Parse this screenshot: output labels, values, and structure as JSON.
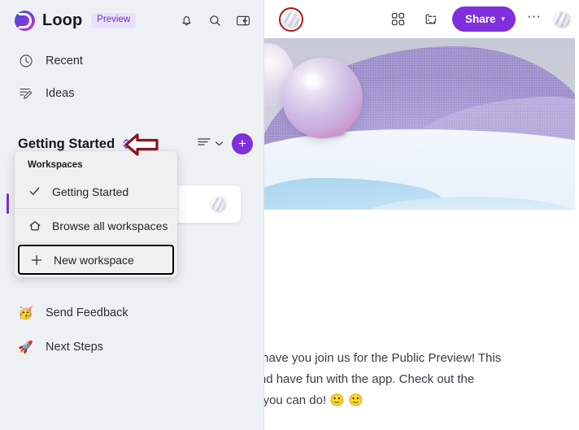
{
  "app": {
    "name": "Loop",
    "badge": "Preview"
  },
  "sidebar": {
    "header_icons": [
      {
        "name": "notifications-icon",
        "label": "Notifications"
      },
      {
        "name": "search-icon",
        "label": "Search"
      },
      {
        "name": "collapse-panel-icon",
        "label": "Collapse navigation"
      }
    ],
    "nav": [
      {
        "label": "Recent",
        "icon": "clock-icon"
      },
      {
        "label": "Ideas",
        "icon": "pencil-board-icon"
      }
    ],
    "workspace": {
      "title": "Getting Started",
      "chevron_icon": "chevron-up-down-icon",
      "sort_icon": "sort-lines-icon",
      "sort_chevron_icon": "chevron-down-icon",
      "add_label": "+"
    },
    "bottom_nav": [
      {
        "label": "Send Feedback",
        "emoji": "🥳"
      },
      {
        "label": "Next Steps",
        "emoji": "🚀"
      }
    ]
  },
  "menu": {
    "section_label": "Workspaces",
    "items": [
      {
        "label": "Getting Started",
        "icon": "check-icon",
        "checked": true
      },
      {
        "label": "Browse all workspaces",
        "icon": "home-icon",
        "checked": false
      },
      {
        "label": "New workspace",
        "icon": "plus-icon",
        "checked": false,
        "highlighted": true
      }
    ]
  },
  "main": {
    "topbar": {
      "doc_icon": "document-thumbnail-icon",
      "grid_icon": "apps-grid-icon",
      "components_icon": "components-icon",
      "share_label": "Share",
      "share_chevron": "⌄",
      "more_label": "⋯",
      "avatar_icon": "user-avatar"
    },
    "hero": {
      "alt": "pastel 3d dunes with spheres banner"
    },
    "body_lines": [
      "l to have you join us for the Public Preview! This",
      "n and have fun with the app. Check out the",
      "uff you can do! 🙂 🙂"
    ]
  },
  "annotations": {
    "arrow": {
      "name": "callout-arrow",
      "color": "#8c1420",
      "direction": "left"
    },
    "ring": {
      "name": "callout-ring",
      "color": "#b31616"
    },
    "box": {
      "name": "callout-box",
      "color": "#000000"
    }
  },
  "colors": {
    "accent": "#7f2fdb",
    "sidebar_bg": "#eef1f3",
    "menu_bg": "#f0f0f0",
    "badge_bg": "#e9e1fb",
    "badge_text": "#6b32c4"
  }
}
